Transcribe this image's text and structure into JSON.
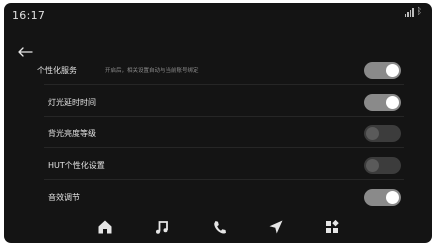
{
  "status_bar": {
    "time": "16:17",
    "signal_icon": "signal-icon",
    "bluetooth_icon": "bluetooth-icon",
    "bluetooth_glyph": "ᛒ"
  },
  "nav": {
    "back_icon": "back-arrow-icon"
  },
  "settings": [
    {
      "label": "个性化服务",
      "hint": "开启后，相关设置自动与当前账号绑定",
      "enabled": true
    },
    {
      "label": "灯光延时时间",
      "enabled": true
    },
    {
      "label": "背光亮度等级",
      "enabled": false
    },
    {
      "label": "HUT个性化设置",
      "enabled": false
    },
    {
      "label": "音效调节",
      "enabled": true
    }
  ],
  "dock": [
    "home-icon",
    "music-icon",
    "phone-icon",
    "navigation-icon",
    "apps-icon"
  ],
  "colors": {
    "screen_bg": "#141414",
    "toggle_on": "#8a8a8a",
    "toggle_off": "#3c3c3c"
  }
}
